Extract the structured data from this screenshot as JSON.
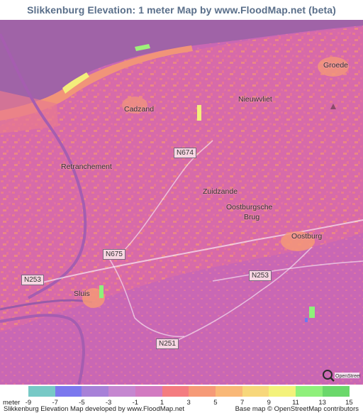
{
  "title": "Slikkenburg Elevation: 1 meter Map by www.FloodMap.net (beta)",
  "places": [
    {
      "name": "Groede",
      "key": "groede"
    },
    {
      "name": "Cadzand",
      "key": "cadzand"
    },
    {
      "name": "Nieuwvliet",
      "key": "nieuwvliet"
    },
    {
      "name": "Retranchement",
      "key": "retranchement"
    },
    {
      "name": "Zuidzande",
      "key": "zuidzande"
    },
    {
      "name": "Oostburgsche",
      "key": "oostburgsche"
    },
    {
      "name": "Brug",
      "key": "brug"
    },
    {
      "name": "Oostburg",
      "key": "oostburg"
    },
    {
      "name": "Sluis",
      "key": "sluis"
    }
  ],
  "roads": [
    {
      "name": "N674",
      "key": "n674"
    },
    {
      "name": "N675",
      "key": "n675"
    },
    {
      "name": "N253",
      "key": "n253-west"
    },
    {
      "name": "N253",
      "key": "n253-east"
    },
    {
      "name": "N251",
      "key": "n251"
    }
  ],
  "legend": {
    "unit_label": "meter",
    "ticks": [
      "-9",
      "-7",
      "-5",
      "-3",
      "-1",
      "1",
      "3",
      "5",
      "7",
      "9",
      "11",
      "13",
      "15"
    ],
    "colors": [
      "#77c9c6",
      "#7b78ee",
      "#a781d8",
      "#c587d0",
      "#d27ac1",
      "#f47c80",
      "#f69a77",
      "#f9b877",
      "#f7d77b",
      "#f3f27b",
      "#8ff07b",
      "#6bd86b"
    ]
  },
  "footer": {
    "credit": "Slikkenburg Elevation Map developed by www.FloodMap.net",
    "basemap": "Base map © OpenStreetMap contributors"
  },
  "map_colors": {
    "sea": "#a063a7",
    "low": "#c766b1",
    "land": "#e46e9c",
    "high": "#f08c7c",
    "green": "#78d870"
  }
}
